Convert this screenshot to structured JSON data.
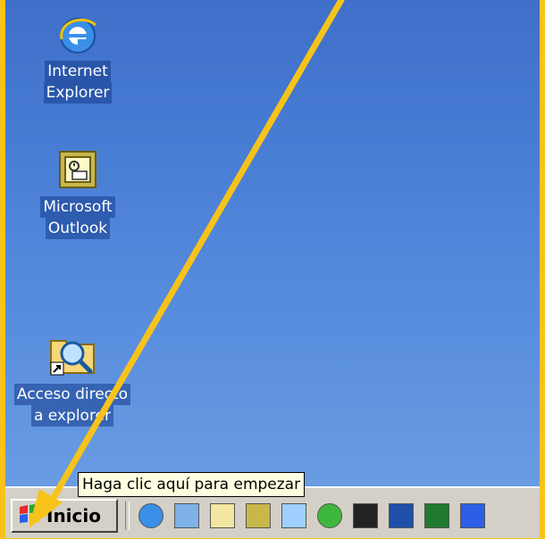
{
  "desktop": {
    "icons": [
      {
        "label_lines": [
          "Internet",
          "Explorer"
        ],
        "icon": "internet-explorer-icon"
      },
      {
        "label_lines": [
          "Microsoft",
          "Outlook"
        ],
        "icon": "outlook-icon"
      },
      {
        "label_lines": [
          "Acceso directo",
          "a explorer"
        ],
        "icon": "explorer-shortcut-icon"
      }
    ]
  },
  "taskbar": {
    "start_label": "Inicio",
    "tooltip": "Haga clic aquí para empezar",
    "quick_launch": [
      "internet-explorer-icon",
      "outlook-express-icon",
      "notepad-icon",
      "clock-icon",
      "search-icon",
      "media-player-icon",
      "program-icon",
      "word-icon",
      "excel-icon",
      "app-icon"
    ]
  },
  "colors": {
    "frame": "#f7c31a",
    "desktop": "#4a7fd6",
    "taskbar": "#d4d0c8",
    "tooltip": "#ffffe1",
    "arrow": "#f7c31a"
  }
}
